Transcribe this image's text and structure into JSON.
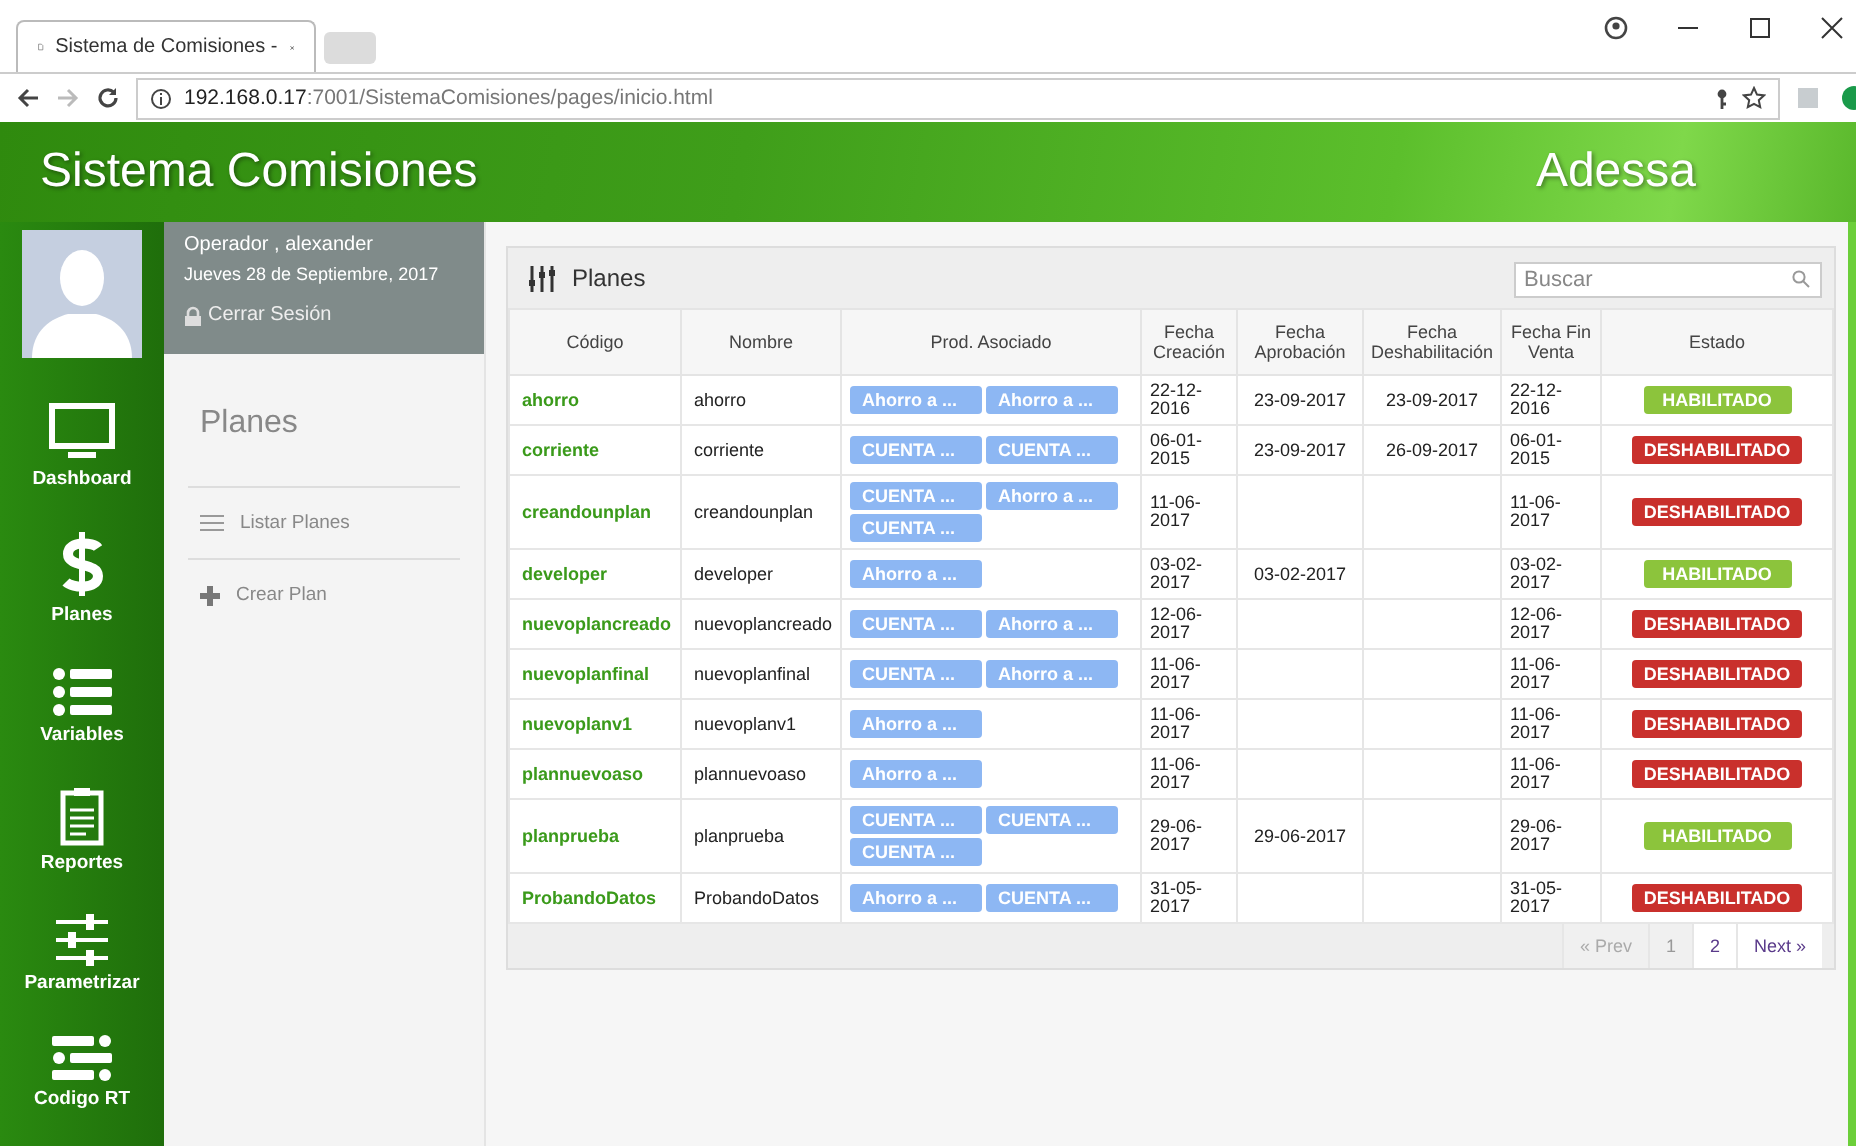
{
  "browser": {
    "tab_title": "Sistema de Comisiones -",
    "url_host": "192.168.0.17",
    "url_path": ":7001/SistemaComisiones/pages/inicio.html"
  },
  "header": {
    "title": "Sistema Comisiones",
    "brand": "Adessa"
  },
  "user": {
    "name": "Operador , alexander",
    "date": "Jueves 28 de Septiembre, 2017",
    "logout": "Cerrar Sesión"
  },
  "nav": [
    {
      "label": "Dashboard",
      "kind": "monitor"
    },
    {
      "label": "Planes",
      "kind": "dollar"
    },
    {
      "label": "Variables",
      "kind": "list"
    },
    {
      "label": "Reportes",
      "kind": "clipboard"
    },
    {
      "label": "Parametrizar",
      "kind": "sliders"
    },
    {
      "label": "Codigo RT",
      "kind": "list2"
    }
  ],
  "side_panel": {
    "title": "Planes",
    "items": [
      {
        "label": "Listar Planes",
        "kind": "list"
      },
      {
        "label": "Crear Plan",
        "kind": "plus"
      }
    ]
  },
  "table": {
    "title": "Planes",
    "search": {
      "placeholder": "Buscar"
    },
    "columns": [
      "Código",
      "Nombre",
      "Prod. Asociado",
      "Fecha Creación",
      "Fecha Aprobación",
      "Fecha Deshabilitación",
      "Fecha Fin Venta",
      "Estado"
    ],
    "rows": [
      {
        "codigo": "ahorro",
        "nombre": "ahorro",
        "productos": [
          "Ahorro a ...",
          "Ahorro a ..."
        ],
        "creacion": "22-12-2016",
        "aprobacion": "23-09-2017",
        "deshabilitacion": "23-09-2017",
        "fin_venta": "22-12-2016",
        "estado": {
          "label": "HABILITADO",
          "kind": "enabled"
        }
      },
      {
        "codigo": "corriente",
        "nombre": "corriente",
        "productos": [
          "CUENTA ...",
          "CUENTA ..."
        ],
        "creacion": "06-01-2015",
        "aprobacion": "23-09-2017",
        "deshabilitacion": "26-09-2017",
        "fin_venta": "06-01-2015",
        "estado": {
          "label": "DESHABILITADO",
          "kind": "disabled"
        }
      },
      {
        "codigo": "creandounplan",
        "nombre": "creandounplan",
        "productos": [
          "CUENTA ...",
          "Ahorro a ...",
          "CUENTA ..."
        ],
        "creacion": "11-06-2017",
        "fin_venta": "11-06-2017",
        "estado": {
          "label": "DESHABILITADO",
          "kind": "disabled"
        }
      },
      {
        "codigo": "developer",
        "nombre": "developer",
        "productos": [
          "Ahorro a ..."
        ],
        "creacion": "03-02-2017",
        "aprobacion": "03-02-2017",
        "fin_venta": "03-02-2017",
        "estado": {
          "label": "HABILITADO",
          "kind": "enabled"
        }
      },
      {
        "codigo": "nuevoplancreado",
        "nombre": "nuevoplancreado",
        "productos": [
          "CUENTA ...",
          "Ahorro a ..."
        ],
        "creacion": "12-06-2017",
        "fin_venta": "12-06-2017",
        "estado": {
          "label": "DESHABILITADO",
          "kind": "disabled"
        }
      },
      {
        "codigo": "nuevoplanfinal",
        "nombre": "nuevoplanfinal",
        "productos": [
          "CUENTA ...",
          "Ahorro a ..."
        ],
        "creacion": "11-06-2017",
        "fin_venta": "11-06-2017",
        "estado": {
          "label": "DESHABILITADO",
          "kind": "disabled"
        }
      },
      {
        "codigo": "nuevoplanv1",
        "nombre": "nuevoplanv1",
        "productos": [
          "Ahorro a ..."
        ],
        "creacion": "11-06-2017",
        "fin_venta": "11-06-2017",
        "estado": {
          "label": "DESHABILITADO",
          "kind": "disabled"
        }
      },
      {
        "codigo": "plannuevoaso",
        "nombre": "plannuevoaso",
        "productos": [
          "Ahorro a ..."
        ],
        "creacion": "11-06-2017",
        "fin_venta": "11-06-2017",
        "estado": {
          "label": "DESHABILITADO",
          "kind": "disabled"
        }
      },
      {
        "codigo": "planprueba",
        "nombre": "planprueba",
        "productos": [
          "CUENTA ...",
          "CUENTA ...",
          "CUENTA ..."
        ],
        "creacion": "29-06-2017",
        "aprobacion": "29-06-2017",
        "fin_venta": "29-06-2017",
        "estado": {
          "label": "HABILITADO",
          "kind": "enabled"
        }
      },
      {
        "codigo": "ProbandoDatos",
        "nombre": "ProbandoDatos",
        "productos": [
          "Ahorro a ...",
          "CUENTA ..."
        ],
        "creacion": "31-05-2017",
        "fin_venta": "31-05-2017",
        "estado": {
          "label": "DESHABILITADO",
          "kind": "disabled"
        }
      }
    ],
    "pagination": {
      "prev": "« Prev",
      "pages": [
        {
          "label": "1",
          "selected": true
        },
        {
          "label": "2",
          "selected": false
        }
      ],
      "next": "Next »"
    }
  }
}
